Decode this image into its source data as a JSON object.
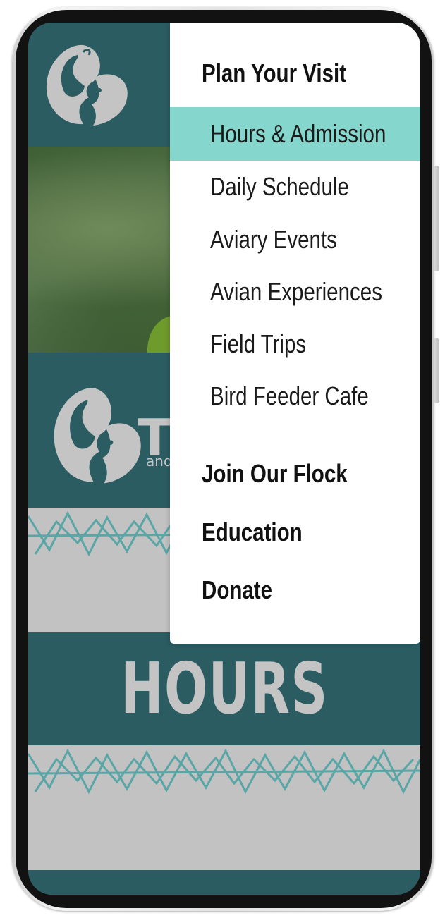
{
  "colors": {
    "accent_teal": "#85d6cd",
    "header_teal": "#2b5c62",
    "band_gray": "#c2c2c2",
    "text_gray": "#c4c4c4",
    "pattern_teal": "#5aa6a6"
  },
  "logo": {
    "icon": "bird-heart-logo-icon"
  },
  "brand": {
    "name_fragment": "TR",
    "sub_fragment": "and"
  },
  "menu": {
    "sections": [
      {
        "label": "Plan Your Visit"
      },
      {
        "label": "Join Our Flock"
      },
      {
        "label": "Education"
      },
      {
        "label": "Donate"
      }
    ],
    "items": [
      {
        "label": "Hours & Admission",
        "active": true
      },
      {
        "label": "Daily Schedule"
      },
      {
        "label": "Aviary Events"
      },
      {
        "label": "Avian Experiences"
      },
      {
        "label": "Field Trips"
      },
      {
        "label": "Bird Feeder Cafe"
      }
    ]
  },
  "page": {
    "title": "HOURS"
  }
}
